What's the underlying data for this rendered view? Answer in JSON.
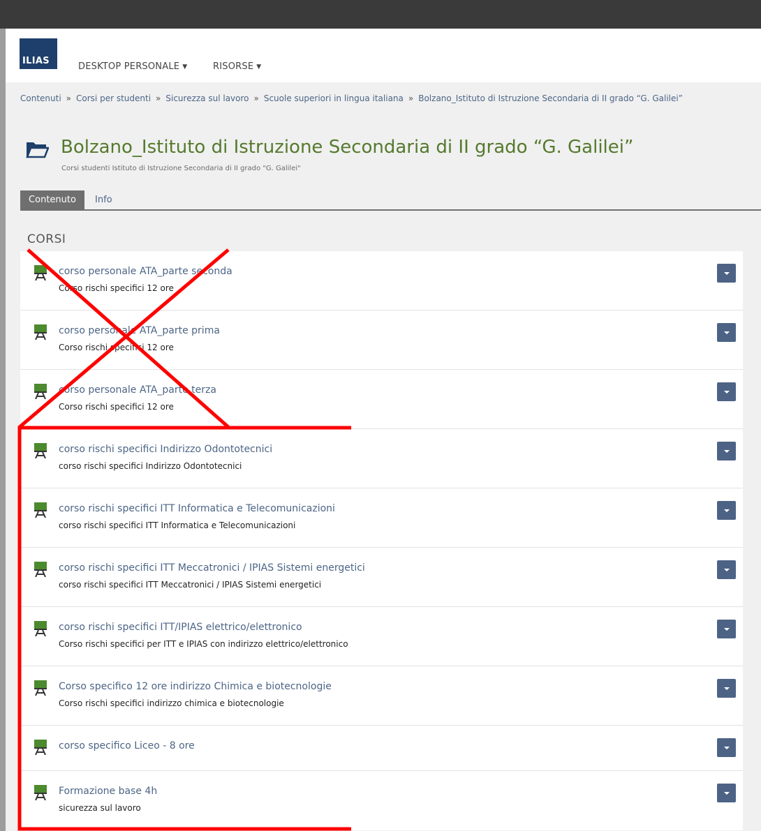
{
  "header": {
    "logo_text": "ILIAS",
    "menu": [
      {
        "label": "DESKTOP PERSONALE"
      },
      {
        "label": "RISORSE"
      }
    ]
  },
  "breadcrumb": [
    "Contenuti",
    "Corsi per studenti",
    "Sicurezza sul lavoro",
    "Scuole superiori in lingua italiana",
    "Bolzano_Istituto di Istruzione Secondaria di II grado “G. Galilei”"
  ],
  "breadcrumb_separator": "»",
  "page": {
    "title": "Bolzano_Istituto di Istruzione Secondaria di II grado “G. Galilei”",
    "subtitle": "Corsi studenti Istituto di Istruzione Secondaria di II grado \"G. Galilei\""
  },
  "tabs": [
    {
      "label": "Contenuto",
      "active": true
    },
    {
      "label": "Info",
      "active": false
    }
  ],
  "section_title": "CORSI",
  "courses": [
    {
      "title": "corso personale ATA_parte seconda",
      "description": "Corso rischi specifici 12 ore"
    },
    {
      "title": "corso personale ATA_parte prima",
      "description": "Corso rischi specifici 12 ore"
    },
    {
      "title": "corso personale ATA_parte terza",
      "description": "Corso rischi specifici 12 ore"
    },
    {
      "title": "corso rischi specifici Indirizzo Odontotecnici",
      "description": "corso rischi specifici Indirizzo Odontotecnici"
    },
    {
      "title": "corso rischi specifici ITT Informatica e Telecomunicazioni",
      "description": "corso rischi specifici ITT Informatica e Telecomunicazioni"
    },
    {
      "title": "corso rischi specifici ITT Meccatronici / IPIAS Sistemi energetici",
      "description": "corso rischi specifici ITT Meccatronici / IPIAS Sistemi energetici"
    },
    {
      "title": "corso rischi specifici ITT/IPIAS elettrico/elettronico",
      "description": "Corso rischi specifici per ITT e IPIAS con indirizzo elettrico/elettronico"
    },
    {
      "title": "Corso specifico 12 ore indirizzo Chimica e biotecnologie",
      "description": "Corso rischi specifici indirizzo chimica e biotecnologie"
    },
    {
      "title": "corso specifico Liceo - 8 ore",
      "description": ""
    },
    {
      "title": "Formazione base 4h",
      "description": "sicurezza sul lavoro"
    }
  ],
  "colors": {
    "topbar": "#3a3a3a",
    "logo_bg": "#1e3f6b",
    "title_green": "#557a2e",
    "link_blue": "#4c6586",
    "action_button": "#4d6385",
    "annotation_red": "#ff0000"
  },
  "icons": {
    "logo": "ilias-logo",
    "folder": "folder-icon",
    "course": "course-board-icon",
    "caret": "caret-down-icon"
  }
}
